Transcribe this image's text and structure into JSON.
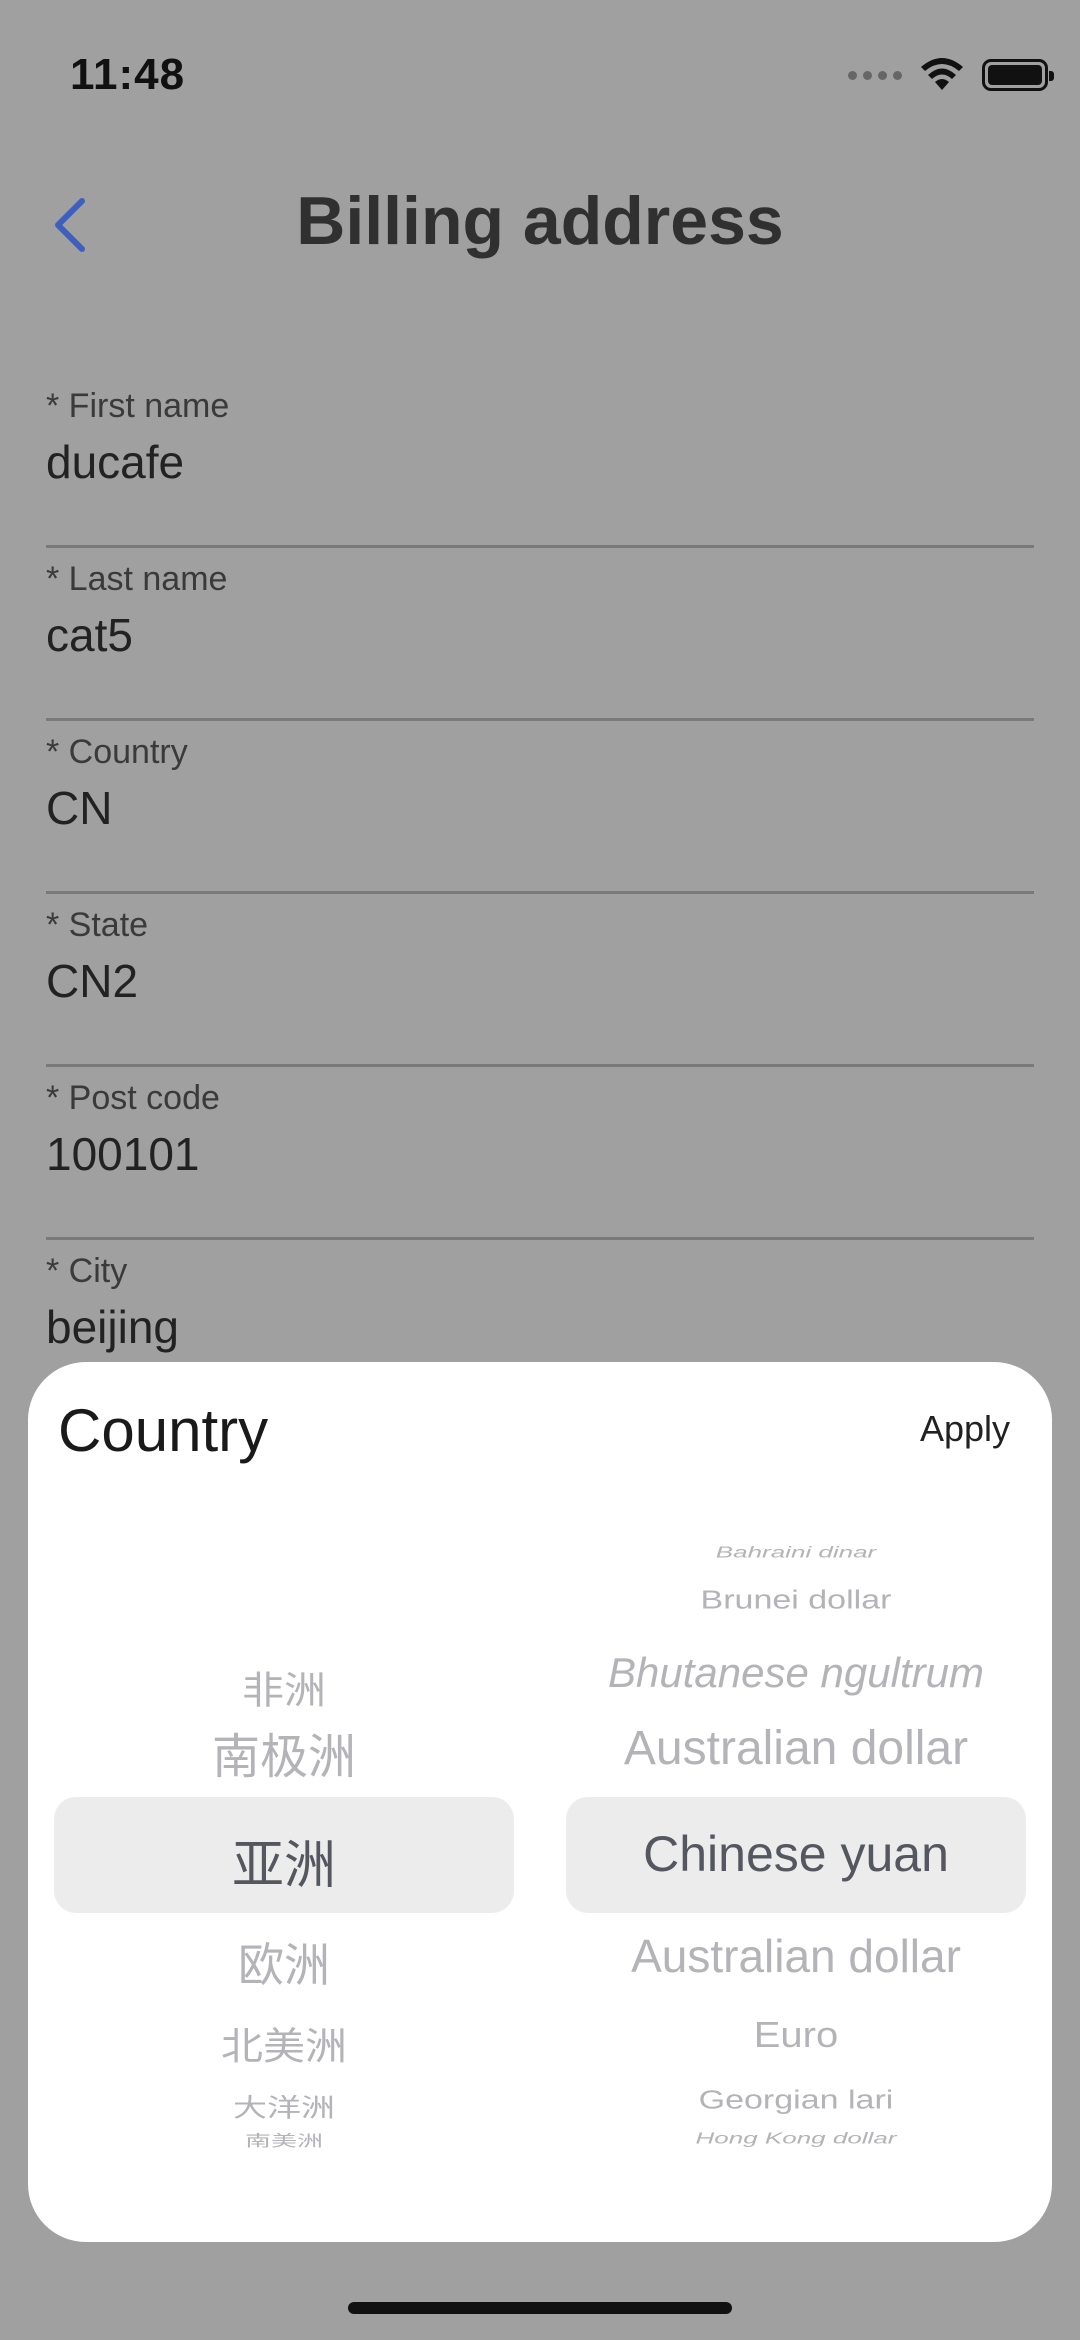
{
  "status_bar": {
    "time": "11:48"
  },
  "header": {
    "title": "Billing address"
  },
  "form": {
    "fields": [
      {
        "label": "* First name",
        "value": "ducafe"
      },
      {
        "label": "* Last name",
        "value": "cat5"
      },
      {
        "label": "* Country",
        "value": "CN"
      },
      {
        "label": "* State",
        "value": "CN2"
      },
      {
        "label": "* Post code",
        "value": "100101"
      },
      {
        "label": "* City",
        "value": "beijing"
      }
    ]
  },
  "sheet": {
    "title": "Country",
    "apply_label": "Apply",
    "continent_picker": {
      "items": [
        "非洲",
        "南极洲",
        "亚洲",
        "欧洲",
        "北美洲",
        "大洋洲",
        "南美洲"
      ],
      "selected": "亚洲"
    },
    "currency_picker": {
      "items": [
        "Bahraini dinar",
        "Brunei dollar",
        "Bhutanese ngultrum",
        "Australian dollar",
        "Chinese yuan",
        "Australian dollar",
        "Euro",
        "Georgian lari",
        "Hong Kong dollar"
      ],
      "selected": "Chinese yuan"
    }
  },
  "colors": {
    "backdrop": "#a0a0a0",
    "accent": "#3f5fbf",
    "selected_text": "#54575f",
    "unselected_text": "#b3b3b8"
  }
}
